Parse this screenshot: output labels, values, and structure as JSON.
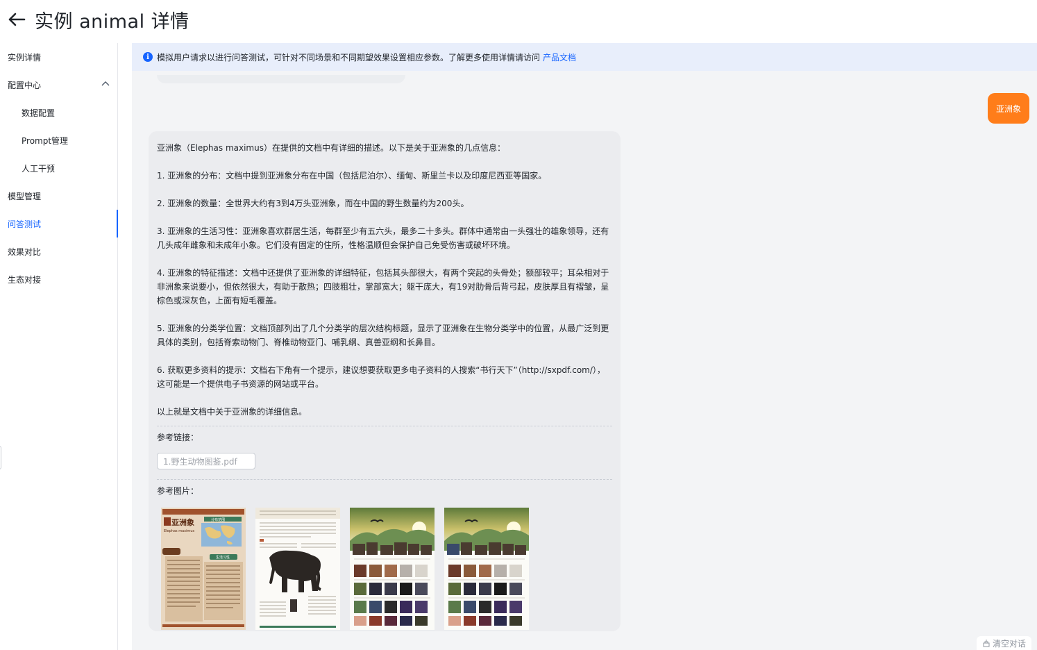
{
  "header": {
    "title": "实例 animal 详情"
  },
  "sidebar": {
    "items": [
      {
        "label": "实例详情"
      },
      {
        "label": "配置中心"
      },
      {
        "label": "数据配置"
      },
      {
        "label": "Prompt管理"
      },
      {
        "label": "人工干预"
      },
      {
        "label": "模型管理"
      },
      {
        "label": "问答测试"
      },
      {
        "label": "效果对比"
      },
      {
        "label": "生态对接"
      }
    ],
    "active": "问答测试"
  },
  "info": {
    "text": "模拟用户请求以进行问答测试，可针对不同场景和不同期望效果设置相应参数。了解更多使用详情请访问",
    "link": "产品文档"
  },
  "chat": {
    "user_message": "亚洲象",
    "answer": {
      "paragraphs": [
        "亚洲象（Elephas maximus）在提供的文档中有详细的描述。以下是关于亚洲象的几点信息：",
        "1. 亚洲象的分布：文档中提到亚洲象分布在中国（包括尼泊尔）、缅甸、斯里兰卡以及印度尼西亚等国家。",
        "2. 亚洲象的数量：全世界大约有3到4万头亚洲象，而在中国的野生数量约为200头。",
        "3. 亚洲象的生活习性：亚洲象喜欢群居生活，每群至少有五六头，最多二十多头。群体中通常由一头强壮的雄象领导，还有几头成年雌象和未成年小象。它们没有固定的住所，性格温顺但会保护自己免受伤害或破坏环境。",
        "4. 亚洲象的特征描述：文档中还提供了亚洲象的详细特征，包括其头部很大，有两个突起的头骨处；额部较平；耳朵相对于非洲象来说要小，但依然很大，有助于散热；四肢粗壮，掌部宽大；躯干庞大，有19对肋骨后背弓起，皮肤厚且有褶皱，呈棕色或深灰色，上面有短毛覆盖。",
        "5. 亚洲象的分类学位置：文档顶部列出了几个分类学的层次结构标题，显示了亚洲象在生物分类学中的位置，从最广泛到更具体的类别，包括脊索动物门、脊椎动物亚门、哺乳纲、真兽亚纲和长鼻目。",
        "6. 获取更多资料的提示：文档右下角有一个提示，建议想要获取更多电子资料的人搜索“书行天下”（http://sxpdf.com/），这可能是一个提供电子书资源的网站或平台。",
        "以上就是文档中关于亚洲象的详细信息。"
      ],
      "ref_links_label": "参考链接：",
      "ref_links": [
        "1.野生动物图鉴.pdf"
      ],
      "ref_images_label": "参考图片：",
      "ref_images_alt": {
        "img1_title": "亚洲象",
        "img1_latin": "Elephas maximus",
        "img1_tag1": "分布范围",
        "img1_tag2": "生活习性"
      }
    },
    "clear_label": "清空对话"
  },
  "colors": {
    "accent": "#1664ff",
    "user_bubble": "#ff7d1a",
    "info_bg": "#e8eefb",
    "chat_bg": "#f3f4f6",
    "card_bg": "#ebecef"
  }
}
